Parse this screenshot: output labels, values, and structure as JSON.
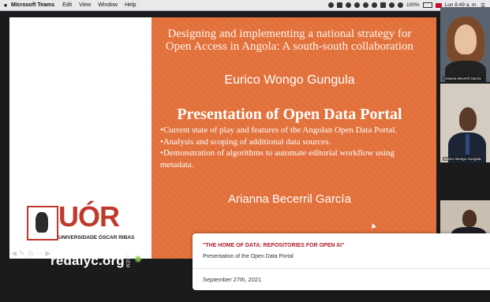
{
  "menubar": {
    "app_name": "Microsoft Teams",
    "menus": [
      "Edit",
      "View",
      "Window",
      "Help"
    ],
    "battery": "100%",
    "clock": "Lun 8:49 a. m."
  },
  "slide": {
    "title": "Designing and implementing a national strategy for Open Access in Angola: A south-south collaboration",
    "author": "Eurico Wongo Gungula",
    "heading": "Presentation of Open Data Portal",
    "bullets": [
      "•Current state of play and features of the Angolan Open Data Portal.",
      "•Analysis and scoping of additional data sources.",
      "•Demonstration of algorithms to automate editorial workflow using metadata."
    ],
    "presenter": "Arianna Becerril García",
    "logo_text": "UÓR",
    "logo_subtext": "UNIVERSIDADE ÓSCAR RIBAS",
    "watermark": "redalyc.org",
    "colors": {
      "slide_bg": "#e2703a",
      "logo": "#c0392b"
    }
  },
  "participants": [
    {
      "label": "Arianna Becerril García"
    },
    {
      "label": "Eurico Wongo Gungula"
    },
    {
      "label": ""
    }
  ],
  "caption_card": {
    "title": "\"THE HOME OF DATA: REPOSITORIES FOR OPEN AI\"",
    "subtitle": "Presentation of the Open Data Portal",
    "date": "September 27th, 2021",
    "title_color": "#b01e2e"
  }
}
